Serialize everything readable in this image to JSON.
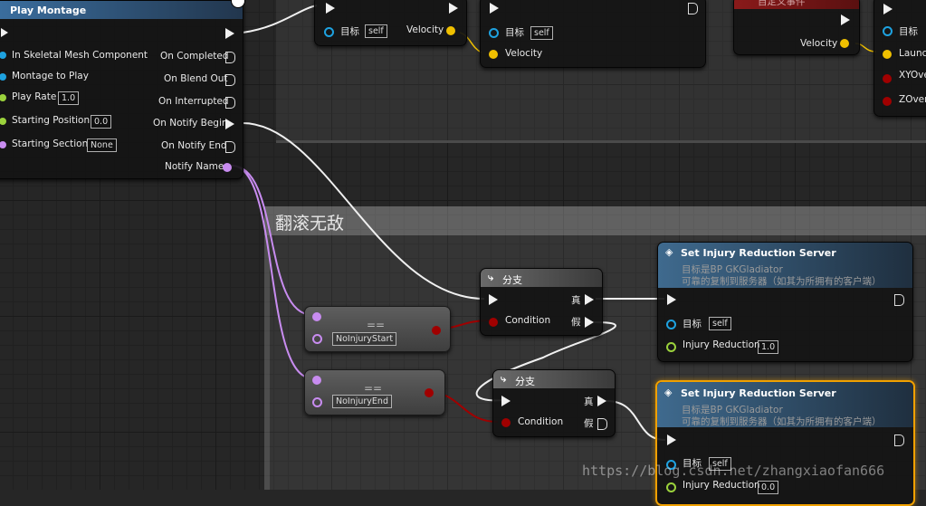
{
  "colors": {
    "exec": "#f0f0f0",
    "object": "#1ea2e0",
    "float": "#9bd23c",
    "vector": "#f0c000",
    "name": "#c88cf0",
    "bool": "#a00000",
    "selected": "#f0a000"
  },
  "comment_title": "翻滚无敌",
  "play_montage": {
    "title": "Play Montage",
    "in_labels": [
      "In Skeletal Mesh Component",
      "Montage to Play",
      "Play Rate",
      "Starting Position",
      "Starting Section"
    ],
    "in_values": {
      "play_rate": "1.0",
      "starting_position": "0.0",
      "starting_section": "None"
    },
    "out_labels": [
      "On Completed",
      "On Blend Out",
      "On Interrupted",
      "On Notify Begin",
      "On Notify End",
      "Notify Name"
    ]
  },
  "top_nodes": {
    "target_label": "目标",
    "self_value": "self",
    "velocity_label": "Velocity",
    "custom_event": "自定义事件",
    "launch_labels": [
      "Launch",
      "XYOverr",
      "ZOverr"
    ]
  },
  "eq1": {
    "symbol": "==",
    "value": "NoInjuryStart"
  },
  "eq2": {
    "symbol": "==",
    "value": "NoInjuryEnd"
  },
  "branch1": {
    "title": "分支",
    "true_label": "真",
    "false_label": "假",
    "condition_label": "Condition"
  },
  "branch2": {
    "title": "分支",
    "true_label": "真",
    "false_label": "假",
    "condition_label": "Condition"
  },
  "set1": {
    "title": "Set Injury Reduction Server",
    "sub1": "目标是BP GKGladiator",
    "sub2": "可靠的复制到服务器（如其为所拥有的客户端）",
    "target_label": "目标",
    "target_value": "self",
    "ir_label": "Injury Reduction",
    "ir_value": "1.0"
  },
  "set2": {
    "title": "Set Injury Reduction Server",
    "sub1": "目标是BP GKGladiator",
    "sub2": "可靠的复制到服务器（如其为所拥有的客户端）",
    "target_label": "目标",
    "target_value": "self",
    "ir_label": "Injury Reduction",
    "ir_value": "0.0"
  },
  "watermark": "https://blog.csdn.net/zhangxiaofan666"
}
